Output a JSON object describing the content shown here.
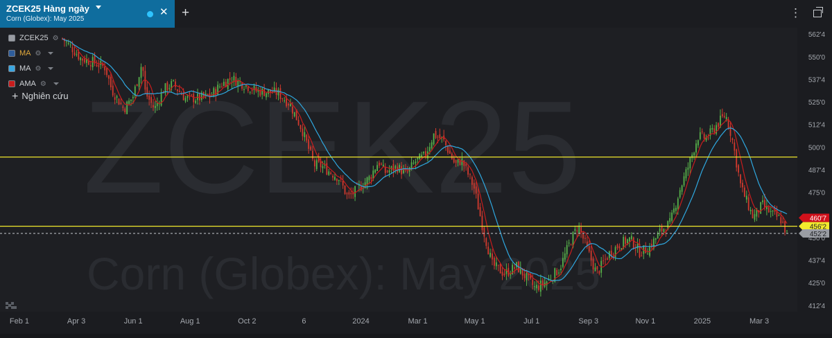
{
  "tab": {
    "title": "ZCEK25 Hàng ngày",
    "subtitle": "Corn (Globex): May 2025"
  },
  "legend": [
    {
      "label": "ZCEK25",
      "color": "#9a9da3",
      "text_color": "#cfd2d6"
    },
    {
      "label": "MA",
      "color": "#2e5d9c",
      "text_color": "#e0a83b"
    },
    {
      "label": "MA",
      "color": "#3aa6e0",
      "text_color": "#cfd2d6"
    },
    {
      "label": "AMA",
      "color": "#c81d1d",
      "text_color": "#cfd2d6"
    }
  ],
  "study_button": "Nghiên cứu",
  "icons": [
    "caret-down-icon",
    "live-dot-icon",
    "close-icon",
    "add-tab-icon",
    "menu-icon",
    "restore-window-icon",
    "gear-icon",
    "tradingview-logo-icon"
  ],
  "watermark": {
    "symbol": "ZCEK25",
    "name": "Corn (Globex): May 2025"
  },
  "chart_data": {
    "type": "candlestick",
    "symbol": "ZCEK25",
    "interval": "Hàng ngày",
    "x_labels": [
      "Feb 1",
      "Apr 3",
      "Jun 1",
      "Aug 1",
      "Oct 2",
      "6",
      "2024",
      "Mar 1",
      "May 1",
      "Jul 1",
      "Sep 3",
      "Nov 1",
      "2025",
      "Mar 3"
    ],
    "y_ticks": [
      {
        "label": "562'4",
        "v": 562.5
      },
      {
        "label": "550'0",
        "v": 550.0
      },
      {
        "label": "537'4",
        "v": 537.5
      },
      {
        "label": "525'0",
        "v": 525.0
      },
      {
        "label": "512'4",
        "v": 512.5
      },
      {
        "label": "500'0",
        "v": 500.0
      },
      {
        "label": "487'4",
        "v": 487.5
      },
      {
        "label": "475'0",
        "v": 475.0
      },
      {
        "label": "450'0",
        "v": 450.0
      },
      {
        "label": "437'4",
        "v": 437.5
      },
      {
        "label": "425'0",
        "v": 425.0
      },
      {
        "label": "412'4",
        "v": 412.5
      }
    ],
    "ylim": [
      409,
      566
    ],
    "horizontal_lines": [
      {
        "label": "494'4",
        "v": 494.5,
        "color": "#f2ea2d"
      },
      {
        "label": "456'2",
        "v": 456.25,
        "color": "#f2ea2d"
      }
    ],
    "price_badges": [
      {
        "label": "460'7",
        "v": 460.875,
        "color": "#d0111b"
      },
      {
        "label": "456'2",
        "v": 456.25,
        "color": "#f2ea2d"
      },
      {
        "label": "452'2",
        "v": 452.25,
        "color": "#9a9da3"
      }
    ],
    "last_price": {
      "label": "452'2",
      "v": 452.25
    },
    "up_color": "#57b24a",
    "down_color": "#d23a2e",
    "ma_colors": {
      "MA": "#2fa8e0",
      "AMA": "#c81d1d"
    },
    "grid": false,
    "price_path": [
      [
        0.0,
        560
      ],
      [
        0.03,
        555
      ],
      [
        0.06,
        549
      ],
      [
        0.1,
        547
      ],
      [
        0.14,
        544
      ],
      [
        0.16,
        532
      ],
      [
        0.2,
        521
      ],
      [
        0.23,
        528
      ],
      [
        0.26,
        547
      ],
      [
        0.27,
        530
      ],
      [
        0.3,
        521
      ],
      [
        0.33,
        532
      ],
      [
        0.36,
        535
      ],
      [
        0.4,
        527
      ],
      [
        0.44,
        527
      ],
      [
        0.48,
        528
      ],
      [
        0.52,
        535
      ],
      [
        0.55,
        538
      ],
      [
        0.6,
        534
      ],
      [
        0.63,
        531
      ],
      [
        0.7,
        530
      ],
      [
        0.74,
        524
      ],
      [
        0.78,
        510
      ],
      [
        0.82,
        490
      ],
      [
        0.84,
        490
      ],
      [
        0.9,
        483
      ],
      [
        0.93,
        472
      ],
      [
        0.97,
        478
      ],
      [
        1.0,
        483
      ],
      [
        1.03,
        492
      ],
      [
        1.05,
        486
      ],
      [
        1.09,
        489
      ],
      [
        1.12,
        485
      ],
      [
        1.15,
        492
      ],
      [
        1.18,
        495
      ],
      [
        1.21,
        507
      ],
      [
        1.24,
        504
      ],
      [
        1.28,
        490
      ],
      [
        1.3,
        493
      ],
      [
        1.34,
        478
      ],
      [
        1.37,
        455
      ],
      [
        1.4,
        435
      ],
      [
        1.44,
        430
      ],
      [
        1.48,
        434
      ],
      [
        1.51,
        428
      ],
      [
        1.54,
        422
      ],
      [
        1.58,
        426
      ],
      [
        1.62,
        433
      ],
      [
        1.65,
        446
      ],
      [
        1.68,
        457
      ],
      [
        1.71,
        443
      ],
      [
        1.74,
        430
      ],
      [
        1.78,
        441
      ],
      [
        1.82,
        447
      ],
      [
        1.85,
        449
      ],
      [
        1.88,
        442
      ],
      [
        1.91,
        444
      ],
      [
        1.95,
        454
      ],
      [
        1.98,
        458
      ],
      [
        2.01,
        476
      ],
      [
        2.04,
        490
      ],
      [
        2.07,
        506
      ],
      [
        2.1,
        505
      ],
      [
        2.13,
        512
      ],
      [
        2.16,
        518
      ],
      [
        2.18,
        506
      ],
      [
        2.21,
        478
      ],
      [
        2.25,
        461
      ],
      [
        2.28,
        468
      ],
      [
        2.31,
        463
      ],
      [
        2.34,
        460
      ],
      [
        2.36,
        452
      ]
    ]
  }
}
